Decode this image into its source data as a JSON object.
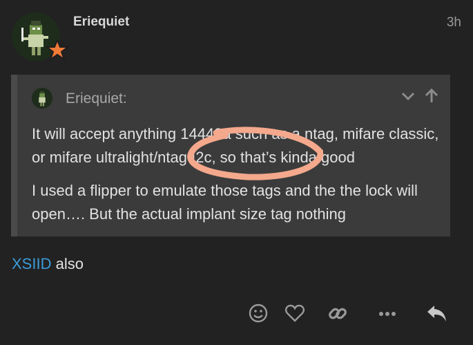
{
  "post": {
    "username": "Eriequiet",
    "timestamp": "3h"
  },
  "quote": {
    "author": "Eriequiet:",
    "paragraphs": [
      "It will accept anything 14443a such as a ntag, mifare classic, or mifare ultralight/ntag I2c, so that’s kinda good",
      "I used a flipper to emulate those tags and the the lock will open…. But the actual implant size tag nothing"
    ]
  },
  "reply": {
    "mention": "XSIID",
    "text": " also"
  },
  "icons": {
    "avatar": "avatar-icon",
    "star": "star-badge-icon",
    "collapse": "chevron-down-icon",
    "jump": "arrow-up-icon",
    "emoji": "smile-icon",
    "like": "heart-icon",
    "link": "link-icon",
    "more": "ellipsis-icon",
    "reply": "reply-icon"
  },
  "colors": {
    "background": "#222222",
    "quote_background": "#3b3b3b",
    "mention": "#3a9bd9",
    "annotation": "#f4a88c",
    "star": "#f07a38"
  }
}
